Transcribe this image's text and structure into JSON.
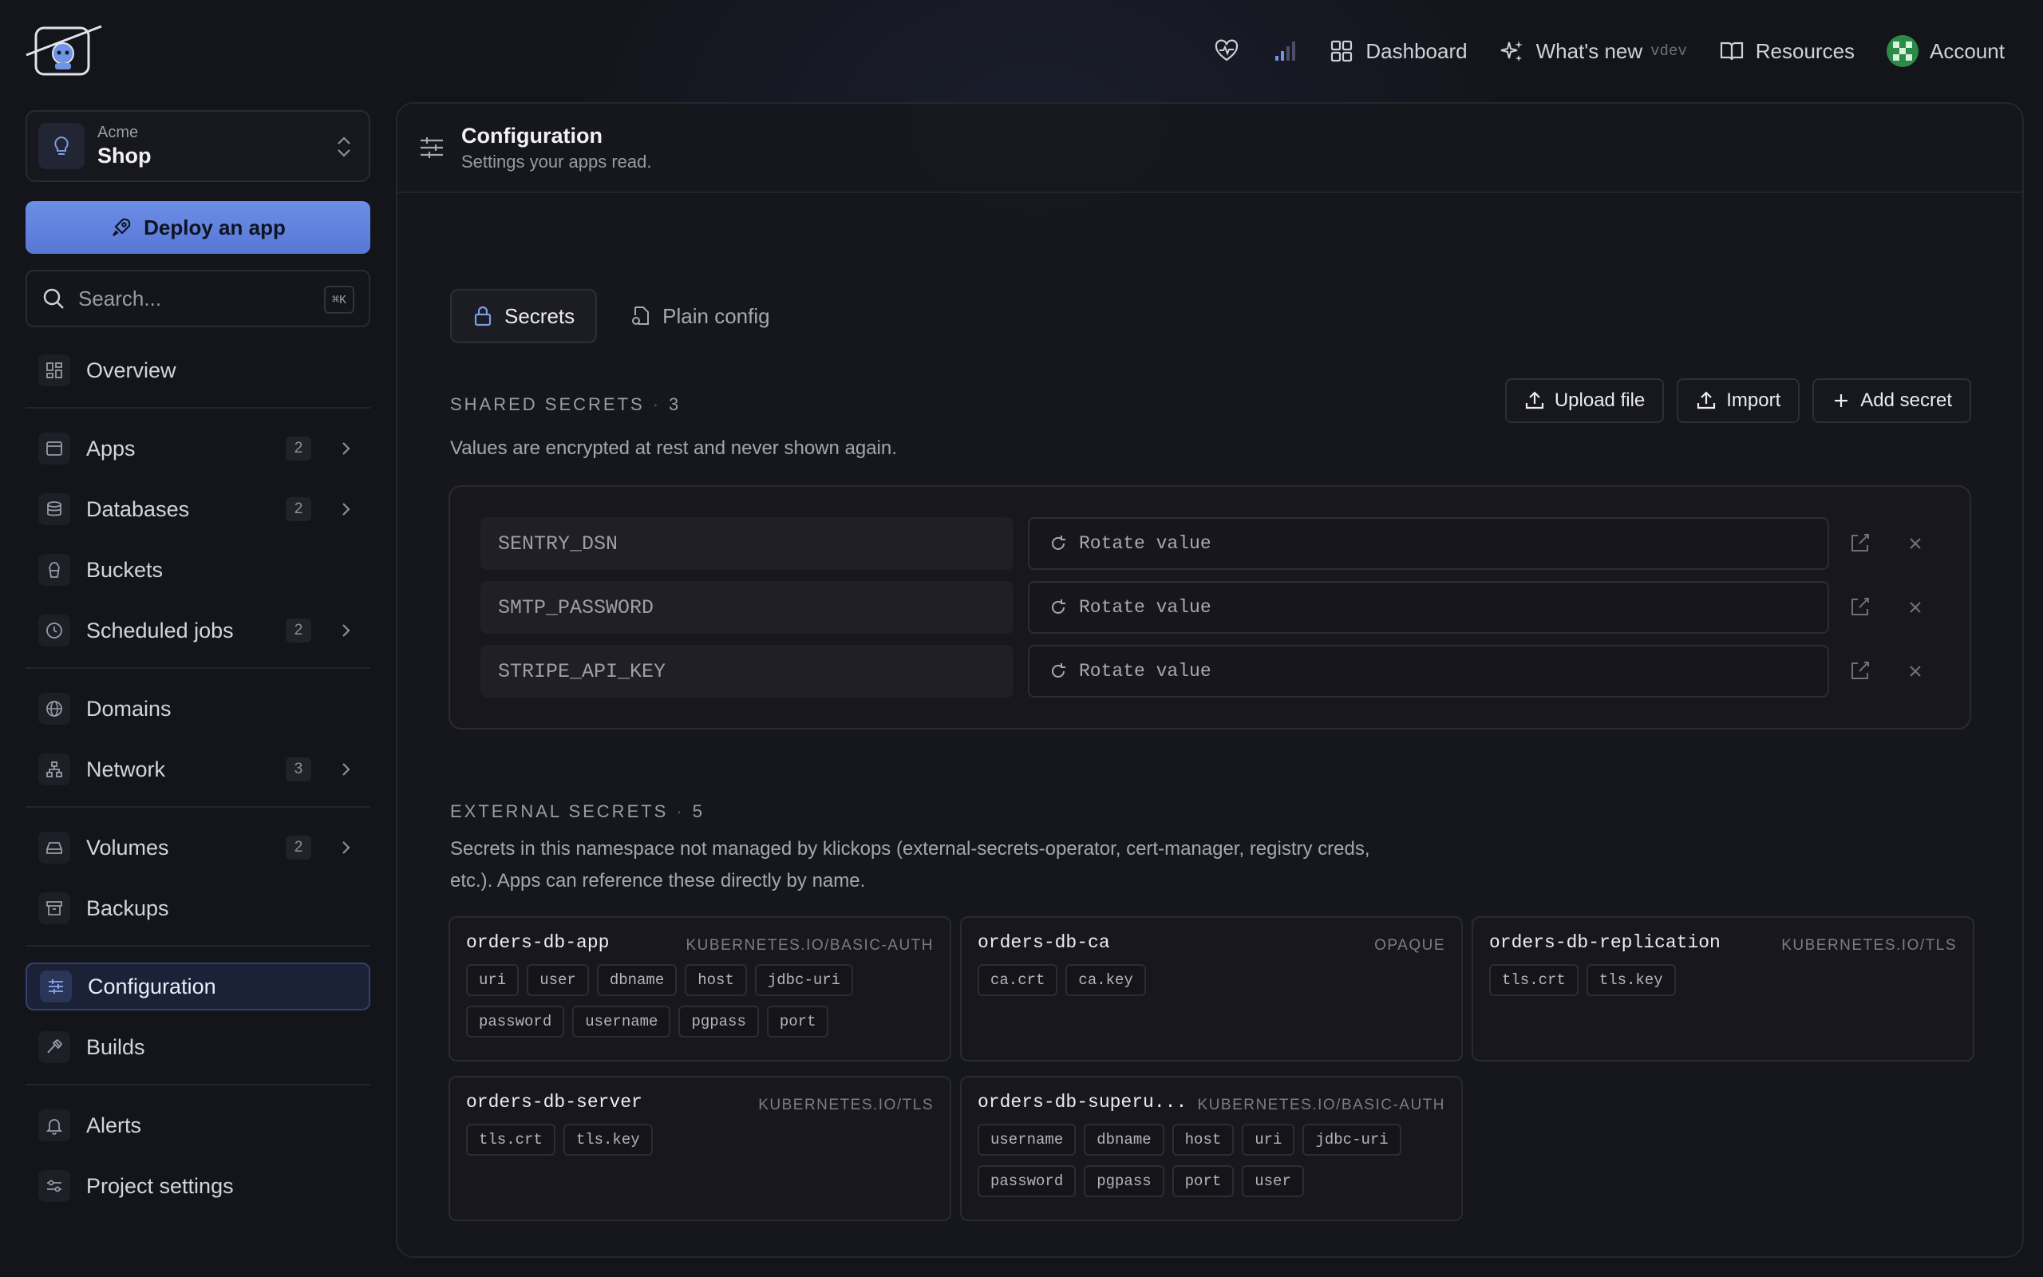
{
  "topnav": {
    "health_icon": "heart-pulse-icon",
    "signal_icon": "signal-bars-icon",
    "dashboard": "Dashboard",
    "whats_new": "What's new",
    "version": "vdev",
    "resources": "Resources",
    "account": "Account"
  },
  "workspace": {
    "org": "Acme",
    "name": "Shop"
  },
  "deploy_label": "Deploy an app",
  "search": {
    "placeholder": "Search...",
    "shortcut": "⌘K"
  },
  "nav": {
    "overview": "Overview",
    "apps": "Apps",
    "apps_count": "2",
    "databases": "Databases",
    "databases_count": "2",
    "buckets": "Buckets",
    "scheduled_jobs": "Scheduled jobs",
    "scheduled_jobs_count": "2",
    "domains": "Domains",
    "network": "Network",
    "network_count": "3",
    "volumes": "Volumes",
    "volumes_count": "2",
    "backups": "Backups",
    "configuration": "Configuration",
    "builds": "Builds",
    "alerts": "Alerts",
    "project_settings": "Project settings"
  },
  "header": {
    "title": "Configuration",
    "subtitle": "Settings your apps read."
  },
  "tabs": {
    "secrets": "Secrets",
    "plain_config": "Plain config"
  },
  "shared": {
    "heading": "SHARED SECRETS",
    "count": "3",
    "description": "Values are encrypted at rest and never shown again.",
    "upload_label": "Upload file",
    "import_label": "Import",
    "add_label": "Add secret",
    "rows": [
      {
        "key": "SENTRY_DSN",
        "value": "Rotate value"
      },
      {
        "key": "SMTP_PASSWORD",
        "value": "Rotate value"
      },
      {
        "key": "STRIPE_API_KEY",
        "value": "Rotate value"
      }
    ]
  },
  "external": {
    "heading": "EXTERNAL SECRETS",
    "count": "5",
    "description_line1": "Secrets in this namespace not managed by klickops (external-secrets-operator, cert-manager, registry creds,",
    "description_line2": "etc.). Apps can reference these directly by name.",
    "cards": [
      {
        "name": "orders-db-app",
        "type": "KUBERNETES.IO/BASIC-AUTH",
        "keys": [
          "uri",
          "user",
          "dbname",
          "host",
          "jdbc-uri",
          "password",
          "username",
          "pgpass",
          "port"
        ]
      },
      {
        "name": "orders-db-ca",
        "type": "OPAQUE",
        "keys": [
          "ca.crt",
          "ca.key"
        ]
      },
      {
        "name": "orders-db-replication",
        "type": "KUBERNETES.IO/TLS",
        "keys": [
          "tls.crt",
          "tls.key"
        ]
      },
      {
        "name": "orders-db-server",
        "type": "KUBERNETES.IO/TLS",
        "keys": [
          "tls.crt",
          "tls.key"
        ]
      },
      {
        "name": "orders-db-superu...",
        "type": "KUBERNETES.IO/BASIC-AUTH",
        "keys": [
          "username",
          "dbname",
          "host",
          "uri",
          "jdbc-uri",
          "password",
          "pgpass",
          "port",
          "user"
        ]
      }
    ]
  }
}
